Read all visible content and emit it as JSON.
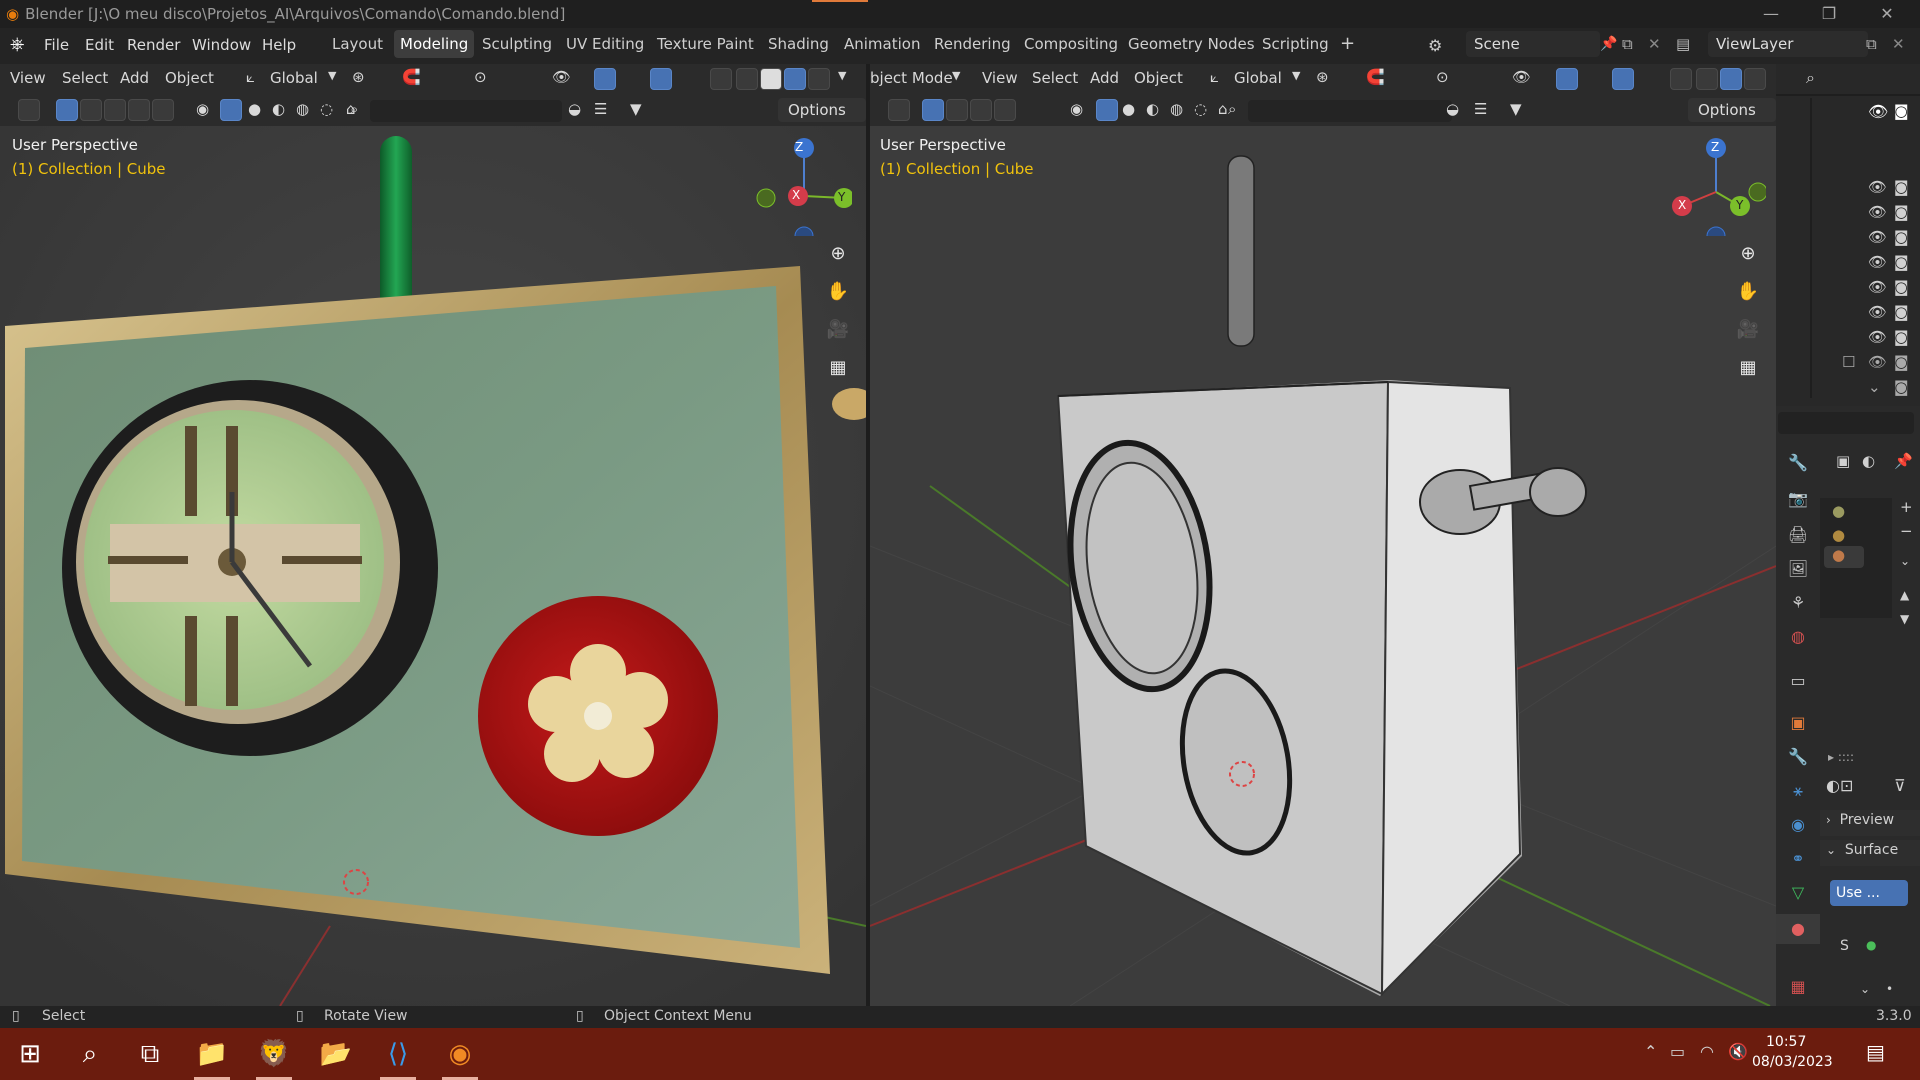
{
  "window": {
    "title": "Blender [J:\\O meu disco\\Projetos_AI\\Arquivos\\Comando\\Comando.blend]",
    "controls": [
      "—",
      "❐",
      "✕"
    ]
  },
  "menubar": {
    "menus": [
      "File",
      "Edit",
      "Render",
      "Window",
      "Help"
    ],
    "workspaces": [
      "Layout",
      "Modeling",
      "Sculpting",
      "UV Editing",
      "Texture Paint",
      "Shading",
      "Animation",
      "Rendering",
      "Compositing",
      "Geometry Nodes",
      "Scripting"
    ],
    "active_workspace": "Modeling",
    "add_workspace": "+",
    "scene": "Scene",
    "view_layer": "ViewLayer"
  },
  "left_viewport": {
    "header_menus": [
      "View",
      "Select",
      "Add",
      "Object"
    ],
    "orientation": "Global",
    "options": "Options",
    "label": "User Perspective",
    "sublabel": "(1) Collection | Cube",
    "gizmo": {
      "x": "X",
      "y": "Y",
      "z": "Z"
    }
  },
  "right_viewport": {
    "mode": "bject Mode",
    "header_menus": [
      "View",
      "Select",
      "Add",
      "Object"
    ],
    "orientation": "Global",
    "options": "Options",
    "label": "User Perspective",
    "sublabel": "(1) Collection | Cube",
    "gizmo": {
      "x": "X",
      "y": "Y",
      "z": "Z"
    }
  },
  "properties": {
    "preview": "Preview",
    "surface": "Surface",
    "use_nodes": "Use ...",
    "s_label": "S"
  },
  "statusbar": {
    "select": "Select",
    "rotate": "Rotate View",
    "context": "Object Context Menu",
    "version": "3.3.0"
  },
  "taskbar": {
    "time": "10:57",
    "date": "08/03/2023"
  },
  "colors": {
    "accent_blue": "#4772b3",
    "active_orange": "#e07a3a",
    "taskbar": "#6b1c0e",
    "text_yellow": "#f0c20d"
  }
}
